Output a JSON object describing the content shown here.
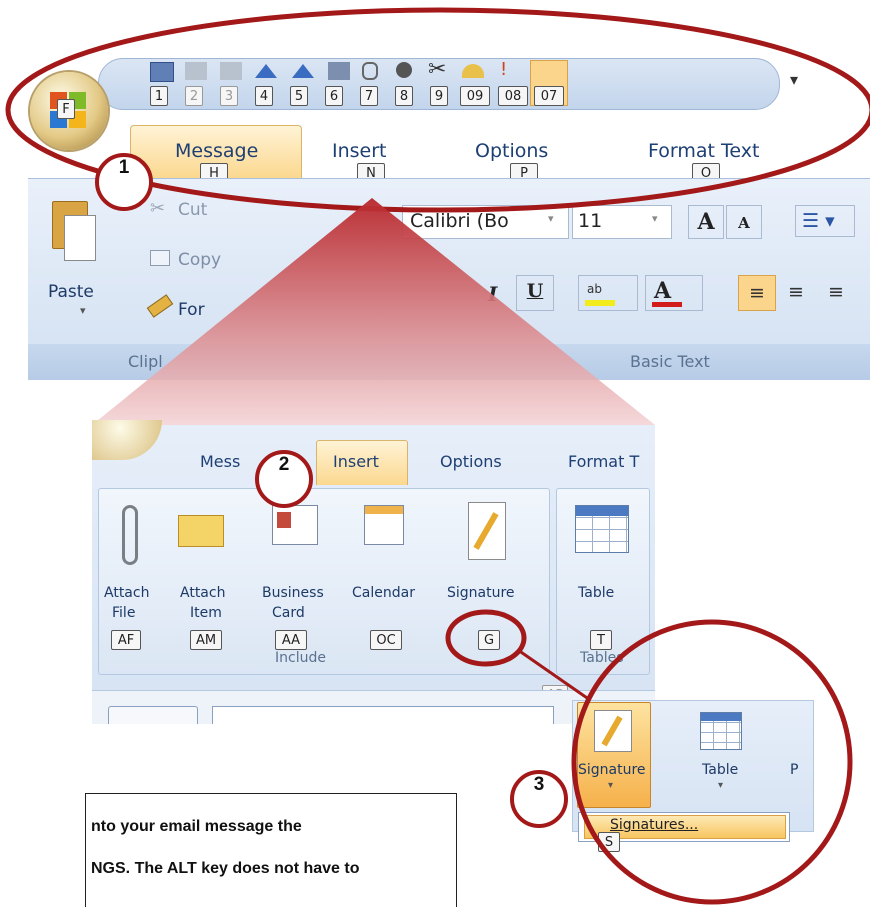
{
  "ribbon_top": {
    "office_key": "F",
    "qat_keytips": [
      "1",
      "2",
      "3",
      "4",
      "5",
      "6",
      "7",
      "8",
      "9",
      "09",
      "08",
      "07"
    ],
    "tabs": [
      {
        "label": "Message",
        "key": "H"
      },
      {
        "label": "Insert",
        "key": "N"
      },
      {
        "label": "Options",
        "key": "P"
      },
      {
        "label": "Format Text",
        "key": "O"
      }
    ],
    "clipboard": {
      "paste": "Paste",
      "cut": "Cut",
      "copy": "Copy",
      "format": "For",
      "group": "Clipl"
    },
    "basic_text": {
      "font": "Calibri (Bo",
      "size": "11",
      "group": "Basic Text",
      "bold_u": "U",
      "italic": "I"
    }
  },
  "ribbon_insert": {
    "tabs": [
      {
        "label": "Mess"
      },
      {
        "label": "Insert"
      },
      {
        "label": "Options"
      },
      {
        "label": "Format T"
      }
    ],
    "buttons": [
      {
        "label1": "Attach",
        "label2": "File",
        "key": "AF"
      },
      {
        "label1": "Attach",
        "label2": "Item",
        "key": "AM"
      },
      {
        "label1": "Business",
        "label2": "Card",
        "key": "AA"
      },
      {
        "label1": "Calendar",
        "label2": "",
        "key": "OC"
      },
      {
        "label1": "Signature",
        "label2": "",
        "key": "G"
      },
      {
        "label1": "Table",
        "label2": "",
        "key": "T"
      }
    ],
    "include_group": "Include",
    "tables_group": "Tables",
    "ap_key": "AP"
  },
  "signature_menu": {
    "signature": "Signature",
    "table": "Table",
    "partial": "P",
    "item": "Signatures...",
    "item_key": "S"
  },
  "callouts": [
    "1",
    "2",
    "3"
  ],
  "note": {
    "line1": "nto your email message the",
    "line2": "NGS. The ALT key does not have to"
  },
  "colors": {
    "accent_red": "#a31818",
    "ribbon_blue": "#dbe7f6",
    "tab_active": "#fce3a8"
  }
}
